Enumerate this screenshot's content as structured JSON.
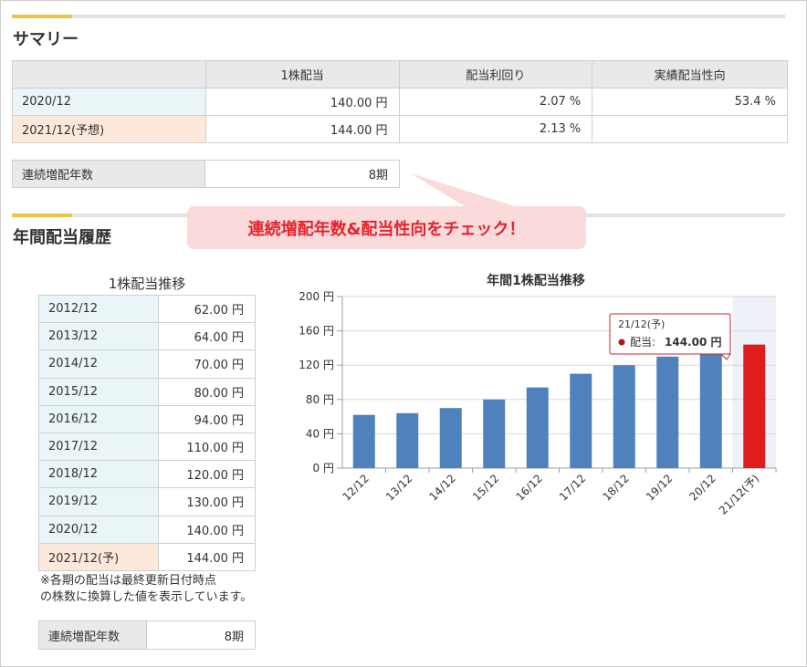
{
  "summary": {
    "title": "サマリー",
    "headers": [
      "",
      "1株配当",
      "配当利回り",
      "実績配当性向"
    ],
    "rows": [
      {
        "period": "2020/12",
        "dividend": "140.00 円",
        "yield": "2.07 %",
        "payout": "53.4 %"
      },
      {
        "period": "2021/12(予想)",
        "dividend": "144.00 円",
        "yield": "2.13 %",
        "payout": ""
      }
    ],
    "streak_label": "連続増配年数",
    "streak_value": "8期"
  },
  "callout": "連続増配年数&配当性向をチェック！",
  "history": {
    "title": "年間配当履歴",
    "caption": "1株配当推移",
    "rows": [
      {
        "year": "2012/12",
        "value": "62.00 円"
      },
      {
        "year": "2013/12",
        "value": "64.00 円"
      },
      {
        "year": "2014/12",
        "value": "70.00 円"
      },
      {
        "year": "2015/12",
        "value": "80.00 円"
      },
      {
        "year": "2016/12",
        "value": "94.00 円"
      },
      {
        "year": "2017/12",
        "value": "110.00 円"
      },
      {
        "year": "2018/12",
        "value": "120.00 円"
      },
      {
        "year": "2019/12",
        "value": "130.00 円"
      },
      {
        "year": "2020/12",
        "value": "140.00 円"
      },
      {
        "year": "2021/12(予)",
        "value": "144.00 円"
      }
    ],
    "note": "※各期の配当は最終更新日付時点\nの株数に換算した値を表示しています。",
    "streak_label": "連続増配年数",
    "streak_value": "8期"
  },
  "colors": {
    "accent": "#e8c547",
    "bar": "#4f81bd",
    "bar_forecast": "#e01d1d",
    "callout_text": "#e8222b",
    "callout_bg": "#fadadb"
  },
  "chart_data": {
    "type": "bar",
    "title": "年間1株配当推移",
    "categories": [
      "12/12",
      "13/12",
      "14/12",
      "15/12",
      "16/12",
      "17/12",
      "18/12",
      "19/12",
      "20/12",
      "21/12(予)"
    ],
    "series": [
      {
        "name": "配当",
        "values": [
          62,
          64,
          70,
          80,
          94,
          110,
          120,
          130,
          140,
          144
        ]
      }
    ],
    "ylim": [
      0,
      200
    ],
    "yticks": [
      0,
      40,
      80,
      120,
      160,
      200
    ],
    "y_unit": "円",
    "highlighted_index": 9,
    "grid": true,
    "tooltip": {
      "title": "21/12(予)",
      "label": "配当: ",
      "value": "144.00 円"
    }
  }
}
